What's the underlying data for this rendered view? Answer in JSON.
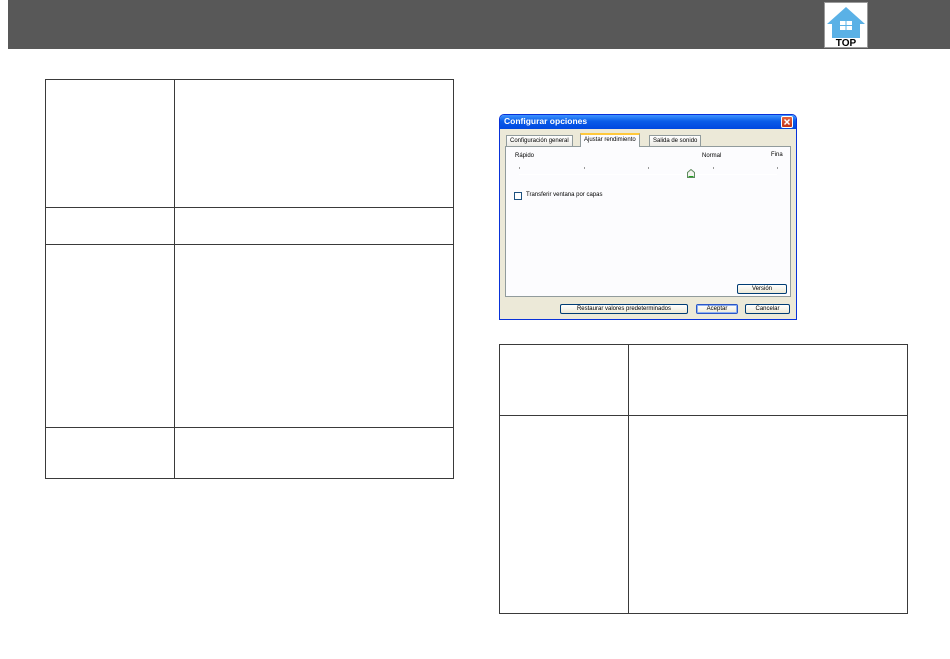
{
  "header": {
    "logo": {
      "icon": "house-icon",
      "label": "TOP"
    },
    "colors": {
      "bar": "#585858",
      "logo_blue": "#5ab1e6"
    }
  },
  "dialog": {
    "title": "Configurar opciones",
    "tabs": [
      {
        "label": "Configuración general",
        "active": false
      },
      {
        "label": "Ajustar rendimiento",
        "active": true
      },
      {
        "label": "Salida de sonido",
        "active": false
      }
    ],
    "slider": {
      "labels": {
        "fast": "Rápido",
        "normal": "Normal",
        "fine": "Fina"
      },
      "stops": 5,
      "selected_stop": 4
    },
    "checkbox": {
      "label": "Transferir ventana por capas",
      "checked": false
    },
    "buttons": {
      "version": "Versión",
      "restore": "Restaurar valores predeterminados",
      "accept": "Aceptar",
      "cancel": "Cancelar"
    }
  }
}
